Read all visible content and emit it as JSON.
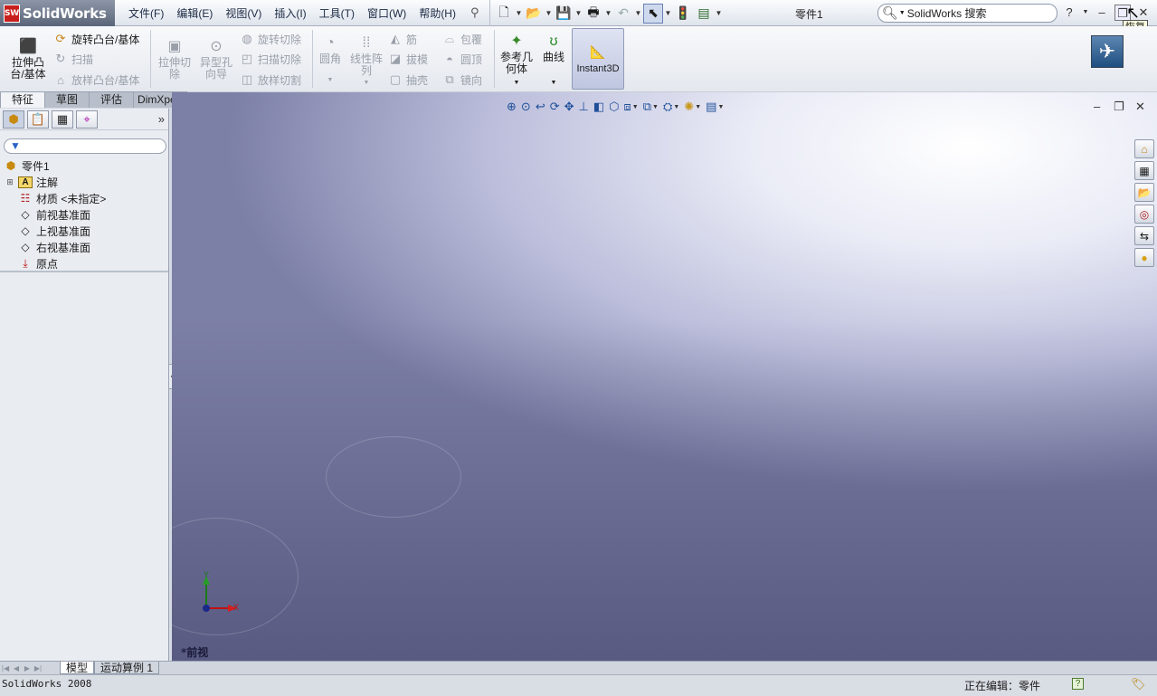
{
  "app": {
    "brand": "SolidWorks",
    "brand_badge": "SW"
  },
  "menu": [
    "文件(F)",
    "编辑(E)",
    "视图(V)",
    "插入(I)",
    "工具(T)",
    "窗口(W)",
    "帮助(H)"
  ],
  "document_title": "零件1",
  "search": {
    "value": "SolidWorks 搜索"
  },
  "window_controls": {
    "help": "?",
    "minimize": "–",
    "restore": "❐",
    "close": "✕",
    "tooltip": "恢复"
  },
  "ribbon": {
    "extrude_boss": "拉伸凸\n台/基体",
    "revolve_boss": "旋转凸台/基体",
    "sweep": "扫描",
    "loft_boss": "放样凸台/基体",
    "extrude_cut": "拉伸切\n除",
    "hole_wizard": "异型孔\n向导",
    "revolve_cut": "旋转切除",
    "sweep_cut": "扫描切除",
    "loft_cut": "放样切割",
    "fillet": "圆角",
    "linear_pattern": "线性阵\n列",
    "rib": "筋",
    "draft": "拔模",
    "shell": "抽壳",
    "wrap": "包覆",
    "dome": "圆顶",
    "mirror": "镜向",
    "ref_geometry": "参考几\n何体",
    "curves": "曲线",
    "instant3d": "Instant3D"
  },
  "tabs": [
    {
      "label": "特征",
      "active": true
    },
    {
      "label": "草图",
      "active": false
    },
    {
      "label": "评估",
      "active": false
    },
    {
      "label": "DimXpert",
      "active": false
    }
  ],
  "tree": {
    "root": "零件1",
    "items": [
      {
        "label": "注解",
        "icon": "annotations-icon",
        "expandable": true
      },
      {
        "label": "材质 <未指定>",
        "icon": "material-icon",
        "expandable": false
      },
      {
        "label": "前视基准面",
        "icon": "plane-icon",
        "expandable": false
      },
      {
        "label": "上视基准面",
        "icon": "plane-icon",
        "expandable": false
      },
      {
        "label": "右视基准面",
        "icon": "plane-icon",
        "expandable": false
      },
      {
        "label": "原点",
        "icon": "origin-icon",
        "expandable": false
      }
    ]
  },
  "bottom_tabs": [
    {
      "label": "模型",
      "active": true
    },
    {
      "label": "运动算例 1",
      "active": false
    }
  ],
  "viewport": {
    "view_label": "*前视",
    "triad": {
      "x": "X",
      "y": "Y"
    }
  },
  "status": {
    "left": "SolidWorks 2008",
    "right": "正在编辑：零件"
  },
  "colors": {
    "viewport_top": "#ffffff",
    "viewport_bottom": "#4b4c72",
    "accent": "#2a64c8"
  }
}
